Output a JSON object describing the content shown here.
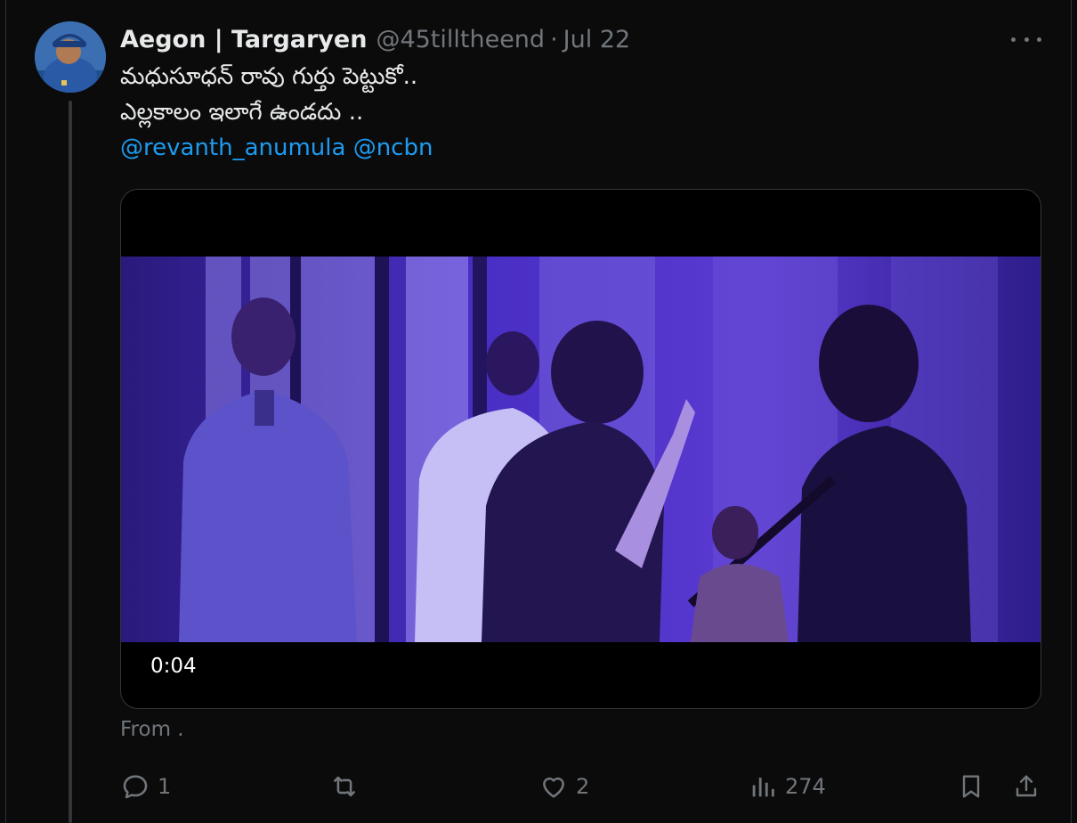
{
  "tweet": {
    "author_name": "Aegon | Targaryen",
    "handle": "@45tilltheend",
    "separator": "·",
    "date": "Jul 22",
    "text_line1": "మధుసూధన్ రావు గుర్తు పెట్టుకో..",
    "text_line2": "ఎల్లకాలం ఇలాగే ఉండదు ..",
    "mentions": [
      "@revanth_anumula",
      "@ncbn"
    ],
    "more_icon": "more-dots-icon"
  },
  "media": {
    "timecode": "0:04",
    "from_label": "From ."
  },
  "actions": {
    "reply_count": "1",
    "retweet_count": "",
    "like_count": "2",
    "views_count": "274",
    "icons": [
      "reply-icon",
      "retweet-icon",
      "like-icon",
      "views-icon",
      "bookmark-icon",
      "share-icon"
    ]
  },
  "colors": {
    "background": "#000000",
    "text": "#e7e9ea",
    "muted": "#71767b",
    "link": "#1d9bf0",
    "border": "#2f3336",
    "video_tint": "#3a1fa8"
  }
}
